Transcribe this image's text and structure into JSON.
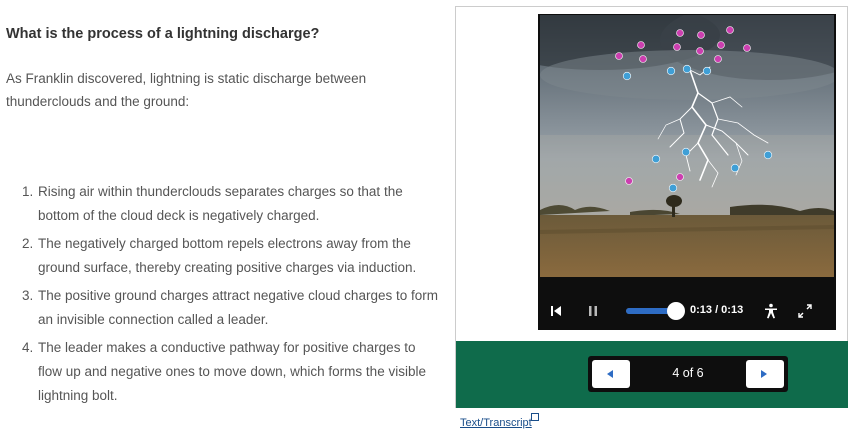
{
  "article": {
    "heading": "What is the process of a lightning discharge?",
    "intro": "As Franklin discovered, lightning is static discharge between thunderclouds and the ground:",
    "steps": [
      {
        "num": "1.",
        "text": "Rising air within thunderclouds separates charges so that the bottom of the cloud deck is negatively charged."
      },
      {
        "num": "2.",
        "text": "The negatively charged bottom repels electrons away from the ground surface, thereby creating positive charges via induction."
      },
      {
        "num": "3.",
        "text": "The positive ground charges attract negative cloud charges to form an invisible connection called a leader."
      },
      {
        "num": "4.",
        "text": "The leader makes a conductive pathway for positive charges to flow up and negative ones to move down, which forms the visible lightning bolt."
      }
    ]
  },
  "video": {
    "time": "0:13 / 0:13",
    "progress": 1.0,
    "icons": {
      "skip_back": "skip-back-icon",
      "pause": "pause-icon",
      "accessibility": "accessibility-icon",
      "fullscreen": "fullscreen-icon"
    }
  },
  "pager": {
    "label": "4 of 6",
    "prev_icon": "chevron-left-icon",
    "next_icon": "chevron-right-icon"
  },
  "transcript": {
    "label": "Text/Transcript",
    "icon": "external-link-icon"
  },
  "colors": {
    "green_bar": "#0f6b4b",
    "player_bg": "#0e0e0e",
    "link": "#1a4e8a",
    "positive_charge": "#cc3fb0",
    "negative_charge": "#3f9fd6"
  }
}
